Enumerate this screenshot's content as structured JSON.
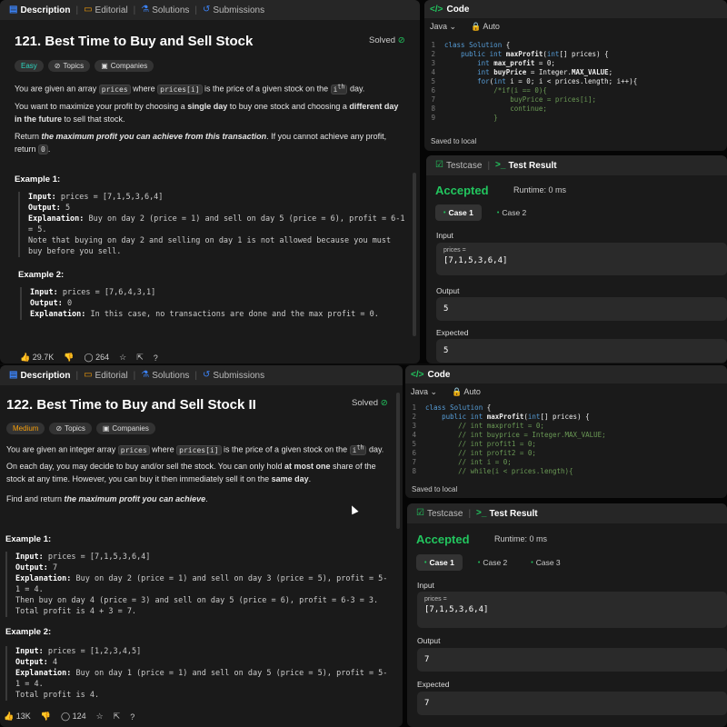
{
  "tabs": {
    "description": "Description",
    "editorial": "Editorial",
    "solutions": "Solutions",
    "submissions": "Submissions"
  },
  "code_label": "Code",
  "lang": "Java",
  "auto": "Auto",
  "saved": "Saved to local",
  "testcase": "Testcase",
  "test_result": "Test Result",
  "accepted": "Accepted",
  "runtime": "Runtime: 0 ms",
  "input_label": "Input",
  "prices_label": "prices =",
  "output_label": "Output",
  "expected_label": "Expected",
  "topics": "Topics",
  "companies": "Companies",
  "solved": "Solved",
  "p1": {
    "title": "121. Best Time to Buy and Sell Stock",
    "difficulty": "Easy",
    "d1a": "You are given an array ",
    "d1b": "prices",
    "d1c": " where ",
    "d1d": "prices[i]",
    "d1e": " is the price of a given stock on the ",
    "d1f": "i",
    "d1g": "th",
    "d1h": " day.",
    "d2a": "You want to maximize your profit by choosing a ",
    "d2b": "single day",
    "d2c": " to buy one stock and choosing a ",
    "d2d": "different day in the future",
    "d2e": " to sell that stock.",
    "d3a": "Return ",
    "d3b": "the maximum profit you can achieve from this transaction",
    "d3c": ". If you cannot achieve any profit, return ",
    "d3d": "0",
    "d3e": ".",
    "ex1_h": "Example 1:",
    "ex1_in_l": "Input:",
    "ex1_in": " prices = [7,1,5,3,6,4]",
    "ex1_out_l": "Output:",
    "ex1_out": " 5",
    "ex1_exp_l": "Explanation:",
    "ex1_exp": " Buy on day 2 (price = 1) and sell on day 5 (price = 6), profit = 6-1 = 5.\nNote that buying on day 2 and selling on day 1 is not allowed because you must buy before you sell.",
    "ex2_h": "Example 2:",
    "ex2_in_l": "Input:",
    "ex2_in": " prices = [7,6,4,3,1]",
    "ex2_out_l": "Output:",
    "ex2_out": " 0",
    "ex2_exp_l": "Explanation:",
    "ex2_exp": " In this case, no transactions are done and the max profit = 0.",
    "likes": "29.7K",
    "comments": "264",
    "code": [
      {
        "n": "1",
        "t": "<span class='kw'>class</span> <span class='kw'>Solution</span> {"
      },
      {
        "n": "2",
        "t": "    <span class='kw'>public int</span> <b>maxProfit</b>(<span class='kw'>int</span>[] prices) {"
      },
      {
        "n": "3",
        "t": "        <span class='kw'>int</span> <b>max_profit</b> = 0;"
      },
      {
        "n": "4",
        "t": "        <span class='kw'>int</span> <b>buyPrice</b> = Integer.<b>MAX_VALUE</b>;"
      },
      {
        "n": "5",
        "t": "        <span class='kw'>for</span>(<span class='kw'>int</span> i = 0; i &lt; prices.length; i++){"
      },
      {
        "n": "6",
        "t": "            <span class='cm'>/*if(i == 0){</span>"
      },
      {
        "n": "7",
        "t": "<span class='cm'>                buyPrice = prices[i];</span>"
      },
      {
        "n": "8",
        "t": "<span class='cm'>                continue;</span>"
      },
      {
        "n": "9",
        "t": "<span class='cm'>            }</span>"
      }
    ],
    "cases": [
      "Case 1",
      "Case 2"
    ],
    "input": "[7,1,5,3,6,4]",
    "output": "5",
    "expected": "5"
  },
  "p2": {
    "title": "122. Best Time to Buy and Sell Stock II",
    "difficulty": "Medium",
    "d1a": "You are given an integer array ",
    "d1b": "prices",
    "d1c": " where ",
    "d1d": "prices[i]",
    "d1e": " is the price of a given stock on the ",
    "d1f": "i",
    "d1g": "th",
    "d1h": " day.",
    "d2a": "On each day, you may decide to buy and/or sell the stock. You can only hold ",
    "d2b": "at most one",
    "d2c": " share of the stock at any time. However, you can buy it then immediately sell it on the ",
    "d2d": "same day",
    "d2e": ".",
    "d3a": "Find and return ",
    "d3b": "the maximum profit you can achieve",
    "d3c": ".",
    "ex1_h": "Example 1:",
    "ex1_in_l": "Input:",
    "ex1_in": " prices = [7,1,5,3,6,4]",
    "ex1_out_l": "Output:",
    "ex1_out": " 7",
    "ex1_exp_l": "Explanation:",
    "ex1_exp": " Buy on day 2 (price = 1) and sell on day 3 (price = 5), profit = 5-1 = 4.\nThen buy on day 4 (price = 3) and sell on day 5 (price = 6), profit = 6-3 = 3.\nTotal profit is 4 + 3 = 7.",
    "ex2_h": "Example 2:",
    "ex2_in_l": "Input:",
    "ex2_in": " prices = [1,2,3,4,5]",
    "ex2_out_l": "Output:",
    "ex2_out": " 4",
    "ex2_exp_l": "Explanation:",
    "ex2_exp": " Buy on day 1 (price = 1) and sell on day 5 (price = 5), profit = 5-1 = 4.\nTotal profit is 4.",
    "likes": "13K",
    "comments": "124",
    "code": [
      {
        "n": "1",
        "t": "<span class='kw'>class</span> <span class='kw'>Solution</span> {"
      },
      {
        "n": "2",
        "t": "    <span class='kw'>public int</span> <b>maxProfit</b>(<span class='kw'>int</span>[] prices) {"
      },
      {
        "n": "3",
        "t": "<span class='cm'>        // int maxprofit = 0;</span>"
      },
      {
        "n": "4",
        "t": "<span class='cm'>        // int buyprice = Integer.MAX_VALUE;</span>"
      },
      {
        "n": "5",
        "t": "<span class='cm'>        // int profit1 = 0;</span>"
      },
      {
        "n": "6",
        "t": "<span class='cm'>        // int profit2 = 0;</span>"
      },
      {
        "n": "7",
        "t": "<span class='cm'>        // int i = 0;</span>"
      },
      {
        "n": "8",
        "t": "<span class='cm'>        // while(i &lt; prices.length){</span>"
      }
    ],
    "cases": [
      "Case 1",
      "Case 2",
      "Case 3"
    ],
    "input": "[7,1,5,3,6,4]",
    "output": "7",
    "expected": "7"
  }
}
